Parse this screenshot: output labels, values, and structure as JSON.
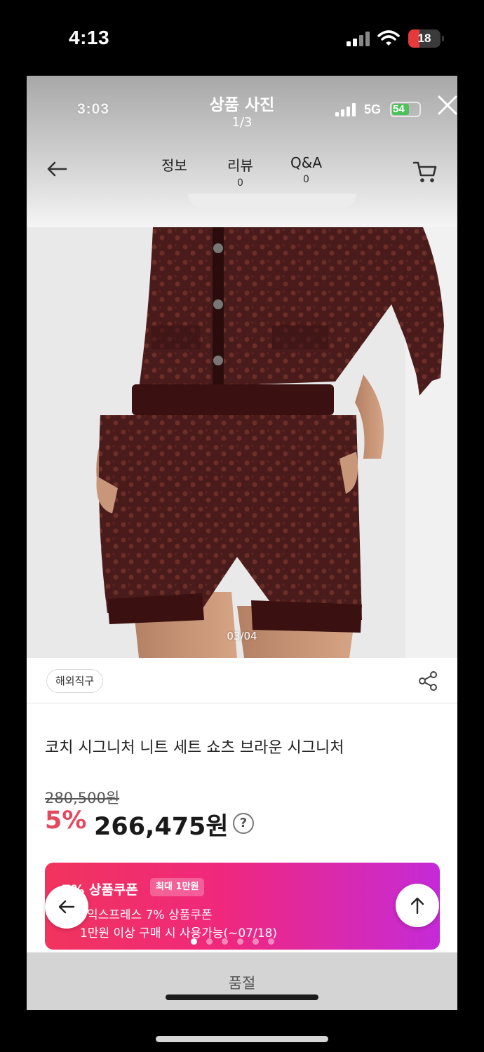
{
  "status_bar": {
    "time": "4:13",
    "battery": "18"
  },
  "inner_status_bar": {
    "time": "3:03",
    "network": "5G",
    "battery": "54"
  },
  "photo_header": {
    "title": "상품 사진",
    "counter": "1/3"
  },
  "nav": {
    "tabs": [
      {
        "label": "정보",
        "count": ""
      },
      {
        "label": "리뷰",
        "count": "0"
      },
      {
        "label": "Q&A",
        "count": "0"
      }
    ]
  },
  "product": {
    "image_counter": "03/04",
    "badge": "해외직구",
    "title": "코치 시그니처 니트 세트 쇼츠 브라운 시그니처",
    "original_price": "280,500원",
    "discount_rate": "5%",
    "sale_price": "266,475원",
    "help_symbol": "?"
  },
  "coupon": {
    "title": "7% 상품쿠폰",
    "tag": "최대 1만원",
    "line1": "익스프레스 7% 상품쿠폰",
    "line2": "1만원 이상 구매 시 사용가능(~07/18)",
    "page_dots": 6,
    "active_dot": 0
  },
  "bottom": {
    "cta_label": "품절"
  },
  "icons": {
    "close": "close-icon",
    "back": "back-arrow-icon",
    "cart": "cart-icon",
    "share": "share-icon",
    "prev": "arrow-left-icon",
    "top": "arrow-up-icon"
  },
  "colors": {
    "discount": "#e34a5d",
    "coupon_start": "#f0345d",
    "coupon_end": "#c52ad8",
    "soldout_bar": "#d4d4d4",
    "knit_brown": "#4a1b1b"
  }
}
